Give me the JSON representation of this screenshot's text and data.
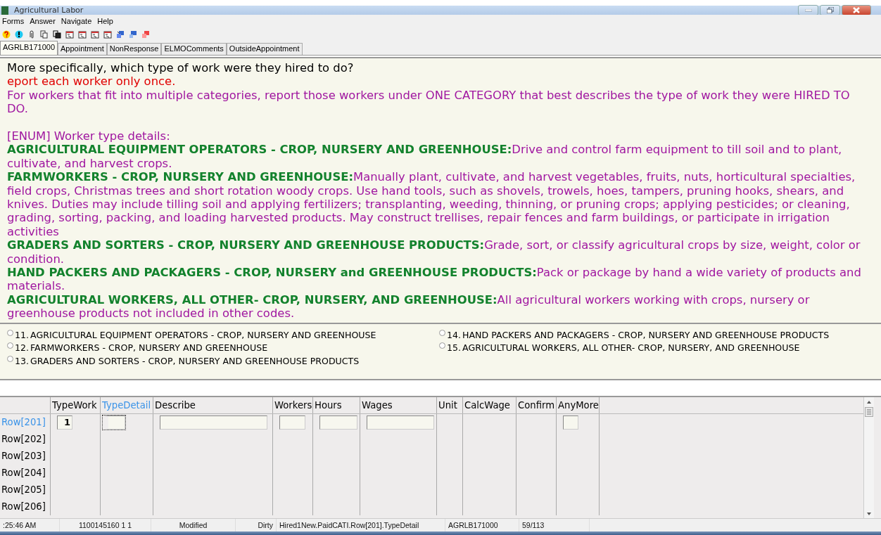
{
  "window": {
    "title": "Agricultural Labor"
  },
  "menu": [
    "Forms",
    "Answer",
    "Navigate",
    "Help"
  ],
  "tabs": [
    {
      "label": "AGRLB171000",
      "selected": true
    },
    {
      "label": "Appointment",
      "selected": false
    },
    {
      "label": "NonResponse",
      "selected": false
    },
    {
      "label": "ELMOComments",
      "selected": false
    },
    {
      "label": "OutsideAppointment",
      "selected": false
    }
  ],
  "question": {
    "text": "More specifically, which type of work were they hired to do?",
    "warning": "eport each worker only once.",
    "instruction": "For workers that fit into multiple categories, report those workers under ONE CATEGORY that best describes the type of work they were HIRED TO DO.",
    "details_heading": "[ENUM] Worker type details:",
    "details": [
      "**AGRICULTURAL EQUIPMENT OPERATORS - CROP, NURSERY AND GREENHOUSE:**Drive and control farm equipment to till soil and to plant, cultivate, and harvest crops.",
      "**FARMWORKERS - CROP, NURSERY AND GREENHOUSE:**Manually plant, cultivate, and harvest vegetables, fruits, nuts, horticultural specialties, field crops, Christmas trees and short rotation woody crops. Use hand tools, such as shovels, trowels, hoes, tampers, pruning hooks, shears, and knives. Duties may include tilling soil and applying fertilizers; transplanting, weeding, thinning, or pruning crops; applying pesticides; or cleaning, grading, sorting, packing, and loading harvested products. May construct trellises, repair fences and farm buildings, or participate in irrigation activities",
      "**GRADERS AND SORTERS - CROP, NURSERY AND GREENHOUSE PRODUCTS:**Grade, sort, or classify agricultural crops by size, weight, color or condition.",
      "**HAND PACKERS AND PACKAGERS - CROP, NURSERY and GREENHOUSE PRODUCTS:**Pack or package by hand a wide variety of products and materials.",
      "**AGRICULTURAL WORKERS, ALL OTHER- CROP, NURSERY, AND GREENHOUSE:**All agricultural workers working with crops, nursery or greenhouse products not included in other codes."
    ]
  },
  "options": [
    {
      "code": "11.",
      "label": "AGRICULTURAL EQUIPMENT OPERATORS - CROP, NURSERY AND GREENHOUSE",
      "selected": false
    },
    {
      "code": "12.",
      "label": "FARMWORKERS  - CROP, NURSERY AND GREENHOUSE",
      "selected": false
    },
    {
      "code": "13.",
      "label": "GRADERS AND SORTERS - CROP, NURSERY AND GREENHOUSE PRODUCTS",
      "selected": false
    },
    {
      "code": "14.",
      "label": "HAND PACKERS AND PACKAGERS - CROP, NURSERY AND GREENHOUSE PRODUCTS",
      "selected": false
    },
    {
      "code": "15.",
      "label": "AGRICULTURAL WORKERS, ALL OTHER- CROP, NURSERY, AND GREENHOUSE",
      "selected": false
    }
  ],
  "grid": {
    "columns": [
      {
        "label": "TypeWork",
        "selected": false
      },
      {
        "label": "TypeDetail",
        "selected": true
      },
      {
        "label": "Describe",
        "selected": false
      },
      {
        "label": "Workers",
        "selected": false
      },
      {
        "label": "Hours",
        "selected": false
      },
      {
        "label": "Wages",
        "selected": false
      },
      {
        "label": "Unit",
        "selected": false
      },
      {
        "label": "CalcWage",
        "selected": false
      },
      {
        "label": "Confirm",
        "selected": false
      },
      {
        "label": "AnyMore",
        "selected": false
      }
    ],
    "rows": [
      {
        "label": "Row[201]",
        "selected": true,
        "cells": [
          {
            "kind": "field",
            "value": "1",
            "focused": false
          },
          {
            "kind": "field",
            "focused": true
          },
          {
            "kind": "field",
            "focused": false
          },
          {
            "kind": "field",
            "focused": false
          },
          {
            "kind": "field",
            "focused": false
          },
          {
            "kind": "field",
            "focused": false
          },
          {
            "kind": "none"
          },
          {
            "kind": "none"
          },
          {
            "kind": "none"
          },
          {
            "kind": "field",
            "focused": false
          }
        ]
      },
      {
        "label": "Row[202]",
        "selected": false
      },
      {
        "label": "Row[203]",
        "selected": false
      },
      {
        "label": "Row[204]",
        "selected": false
      },
      {
        "label": "Row[205]",
        "selected": false
      },
      {
        "label": "Row[206]",
        "selected": false
      }
    ]
  },
  "status_bar": [
    ":25:46 AM",
    "1100145160 1 1",
    "Modified",
    "Dirty",
    "Hired1New.PaidCATI.Row[201].TypeDetail",
    "AGRLB171000",
    "59/113"
  ]
}
